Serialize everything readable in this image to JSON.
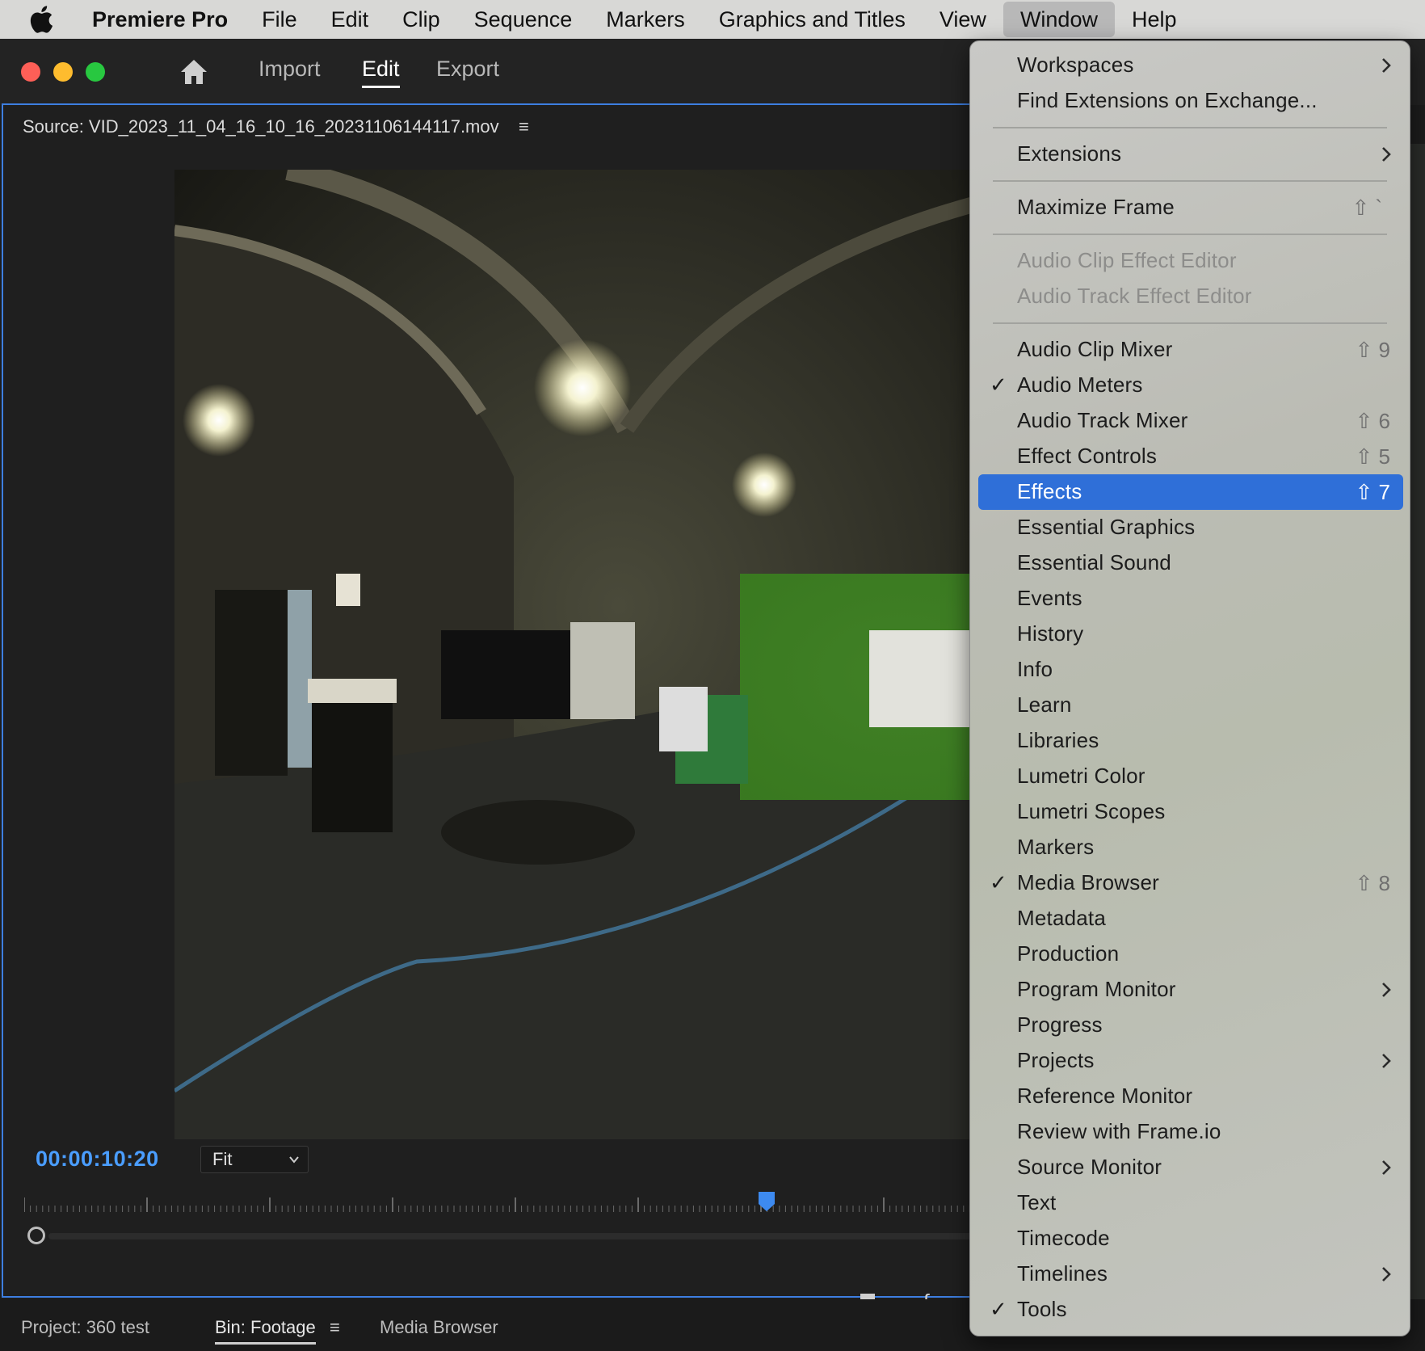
{
  "menubar": {
    "app_name": "Premiere Pro",
    "items": [
      "File",
      "Edit",
      "Clip",
      "Sequence",
      "Markers",
      "Graphics and Titles",
      "View",
      "Window",
      "Help"
    ],
    "active_item": "Window"
  },
  "workspace_tabs": {
    "import": "Import",
    "edit": "Edit",
    "export": "Export",
    "active": "Edit"
  },
  "source_monitor": {
    "title": "Source: VID_2023_11_04_16_10_16_20231106144117.mov",
    "timecode": "00:00:10:20",
    "zoom": "Fit"
  },
  "bottom_tabs": {
    "project": "Project: 360 test",
    "bin": "Bin: Footage",
    "media_browser": "Media Browser"
  },
  "window_menu": {
    "items": [
      {
        "label": "Workspaces",
        "submenu": true
      },
      {
        "label": "Find Extensions on Exchange..."
      },
      {
        "separator": true
      },
      {
        "label": "Extensions",
        "submenu": true
      },
      {
        "separator": true
      },
      {
        "label": "Maximize Frame",
        "shortcut": "⇧ `"
      },
      {
        "separator": true
      },
      {
        "label": "Audio Clip Effect Editor",
        "disabled": true
      },
      {
        "label": "Audio Track Effect Editor",
        "disabled": true
      },
      {
        "separator": true
      },
      {
        "label": "Audio Clip Mixer",
        "shortcut": "⇧ 9"
      },
      {
        "label": "Audio Meters",
        "checked": true
      },
      {
        "label": "Audio Track Mixer",
        "shortcut": "⇧ 6"
      },
      {
        "label": "Effect Controls",
        "shortcut": "⇧ 5"
      },
      {
        "label": "Effects",
        "shortcut": "⇧ 7",
        "highlighted": true
      },
      {
        "label": "Essential Graphics"
      },
      {
        "label": "Essential Sound"
      },
      {
        "label": "Events"
      },
      {
        "label": "History"
      },
      {
        "label": "Info"
      },
      {
        "label": "Learn"
      },
      {
        "label": "Libraries"
      },
      {
        "label": "Lumetri Color"
      },
      {
        "label": "Lumetri Scopes"
      },
      {
        "label": "Markers"
      },
      {
        "label": "Media Browser",
        "checked": true,
        "shortcut": "⇧ 8"
      },
      {
        "label": "Metadata"
      },
      {
        "label": "Production"
      },
      {
        "label": "Program Monitor",
        "submenu": true
      },
      {
        "label": "Progress"
      },
      {
        "label": "Projects",
        "submenu": true
      },
      {
        "label": "Reference Monitor"
      },
      {
        "label": "Review with Frame.io"
      },
      {
        "label": "Source Monitor",
        "submenu": true
      },
      {
        "label": "Text"
      },
      {
        "label": "Timecode"
      },
      {
        "label": "Timelines",
        "submenu": true
      },
      {
        "label": "Tools",
        "checked": true
      }
    ]
  },
  "colors": {
    "accent": "#3d7ee0",
    "timecode": "#4a9dff",
    "menu_highlight": "#2f6fd8"
  }
}
